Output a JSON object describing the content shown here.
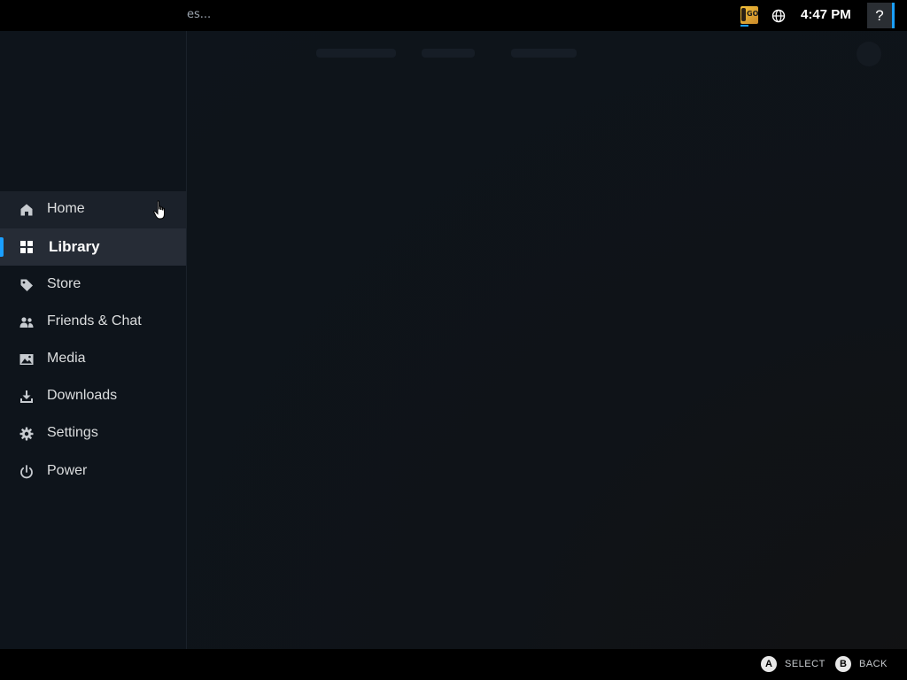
{
  "topbar": {
    "title": "es...",
    "game_icon_text": "GO",
    "clock": "4:47 PM",
    "help_label": "?"
  },
  "sidebar": {
    "items": [
      {
        "label": "Home",
        "icon": "home-icon",
        "state": "hover"
      },
      {
        "label": "Library",
        "icon": "grid-icon",
        "state": "active"
      },
      {
        "label": "Store",
        "icon": "tag-icon",
        "state": "normal"
      },
      {
        "label": "Friends & Chat",
        "icon": "friends-icon",
        "state": "normal"
      },
      {
        "label": "Media",
        "icon": "image-icon",
        "state": "normal"
      },
      {
        "label": "Downloads",
        "icon": "download-icon",
        "state": "normal"
      },
      {
        "label": "Settings",
        "icon": "gear-icon",
        "state": "normal"
      },
      {
        "label": "Power",
        "icon": "power-icon",
        "state": "normal"
      }
    ]
  },
  "footer": {
    "select_button": "A",
    "select_label": "SELECT",
    "back_button": "B",
    "back_label": "BACK"
  },
  "colors": {
    "accent": "#1a9fff",
    "sidebar_bg": "#0e141b",
    "active_bg": "#262c36"
  }
}
